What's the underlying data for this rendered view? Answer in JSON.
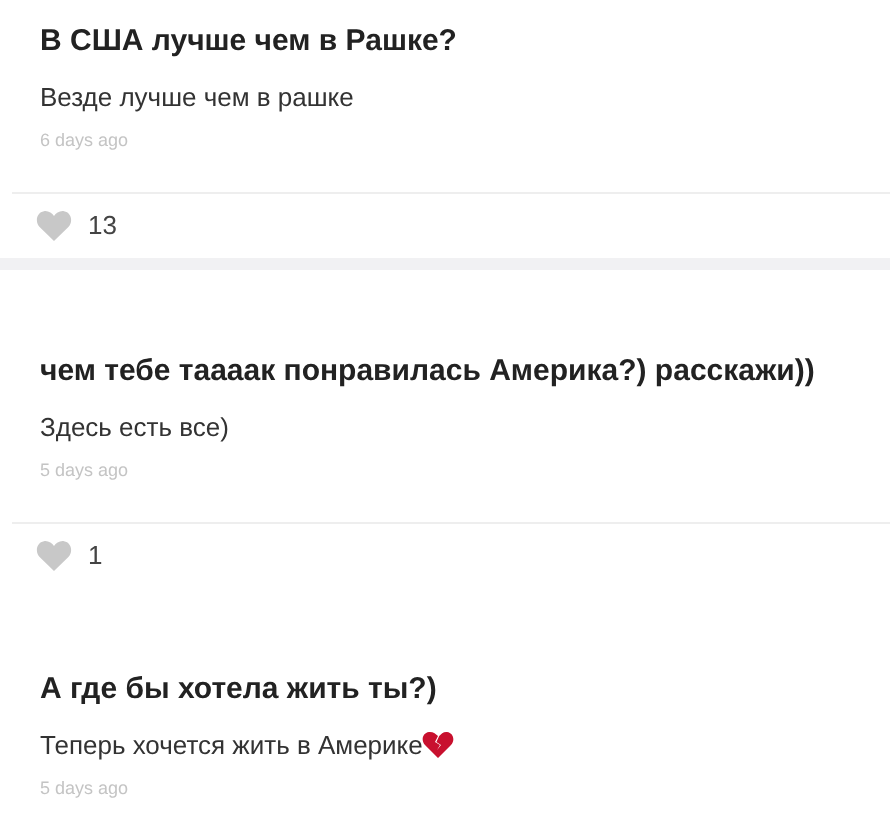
{
  "posts": [
    {
      "question": "В США лучше чем в Рашке?",
      "answer": "Везде лучше чем в рашке",
      "time": "6 days ago",
      "likes": "13",
      "separated": true
    },
    {
      "question": "чем тебе тааaак понравилась Америка?) расскажи))",
      "answer": "Здесь есть все)",
      "time": "5 days ago",
      "likes": "1",
      "separated": false
    },
    {
      "question": "А где бы хотела жить ты?)",
      "answer": "Теперь хочется жить в Америке",
      "broken_heart": true,
      "time": "5 days ago"
    }
  ]
}
